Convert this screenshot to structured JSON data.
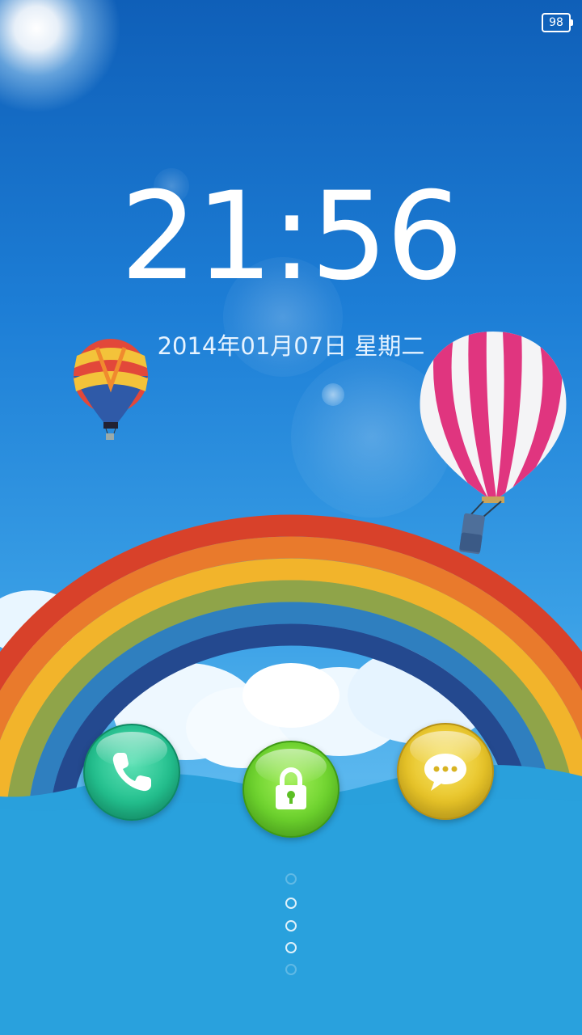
{
  "status_bar": {
    "battery_level": "98"
  },
  "lockscreen": {
    "time": "21:56",
    "date": "2014年01月07日 星期二"
  },
  "shortcuts": {
    "phone_icon": "phone-icon",
    "unlock_icon": "lock-icon",
    "messages_icon": "message-bubble-icon"
  },
  "colors": {
    "sky": "#1d7ed6",
    "phone_button": "#23c08e",
    "unlock_button": "#6cd22d",
    "messages_button": "#e8c428",
    "rainbow": [
      "#d8412a",
      "#e97a2c",
      "#f2b42b",
      "#8fa449",
      "#2f7fbf",
      "#24498f"
    ]
  }
}
